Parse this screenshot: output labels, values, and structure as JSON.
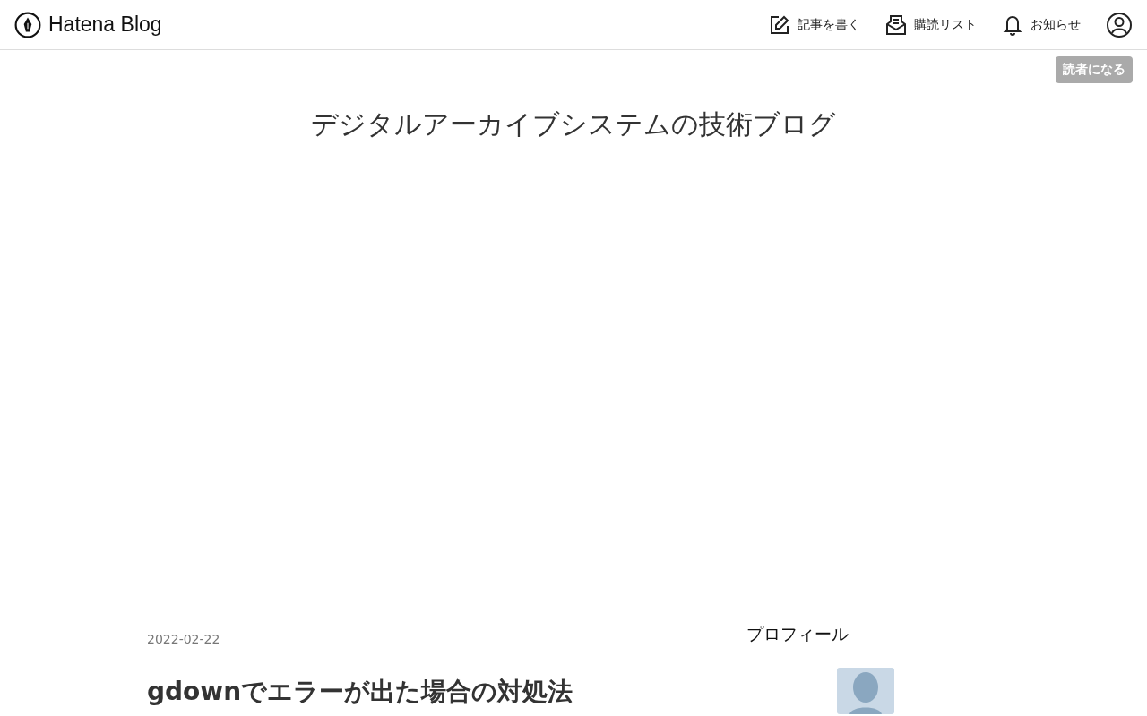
{
  "header": {
    "logo": "Hatena Blog",
    "nav": [
      {
        "kind": "write",
        "label": "記事を書く"
      },
      {
        "kind": "subscriptions",
        "label": "購読リスト"
      },
      {
        "kind": "notifications",
        "label": "お知らせ"
      }
    ]
  },
  "subscribe_button": "読者になる",
  "blog_title": "デジタルアーカイブシステムの技術ブログ",
  "entry": {
    "date": "2022-02-22",
    "title": "gdownでエラーが出た場合の対処法"
  },
  "sidebar": {
    "heading": "プロフィール"
  }
}
